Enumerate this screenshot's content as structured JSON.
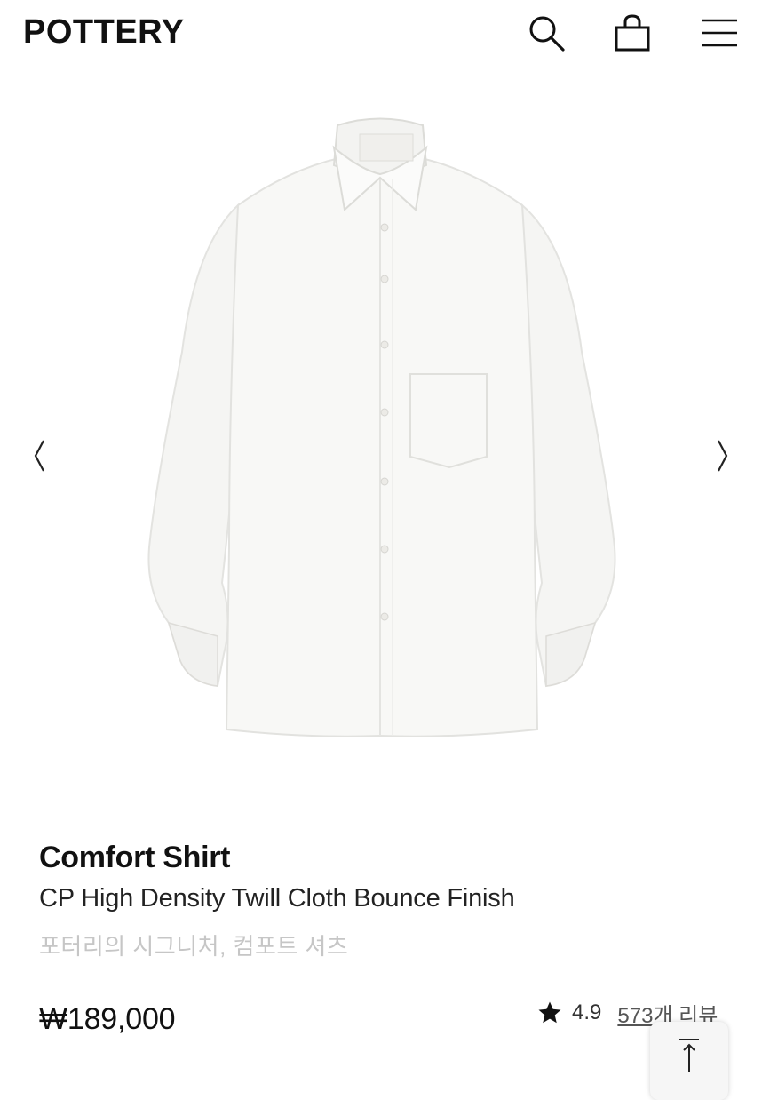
{
  "header": {
    "logo": "POTTERY",
    "icons": [
      "search-icon",
      "shopping-bag-icon",
      "hamburger-menu-icon"
    ]
  },
  "gallery": {
    "image": "white-comfort-shirt",
    "prev": "‹",
    "next": "›"
  },
  "product": {
    "name": "Comfort Shirt",
    "subtitle": "CP High Density Twill Cloth Bounce Finish",
    "description": "포터리의 시그니처, 컴포트 셔츠",
    "price": "₩189,000",
    "rating": "4.9",
    "reviews": "573개 리뷰"
  },
  "colors": {
    "text": "#111111",
    "muted": "#c6c6c6",
    "shirt": "#f7f7f5"
  }
}
